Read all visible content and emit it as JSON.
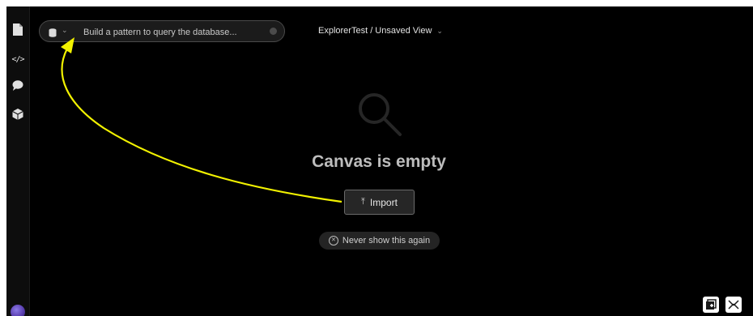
{
  "sidebar": {
    "items": [
      {
        "icon": "file-icon"
      },
      {
        "icon": "code-icon",
        "glyph": "</>"
      },
      {
        "icon": "chat-icon"
      },
      {
        "icon": "cube-icon"
      }
    ],
    "avatar_icon": "avatar-icon"
  },
  "search": {
    "db_icon": "database-icon",
    "placeholder": "Build a pattern to query the database..."
  },
  "header": {
    "view_title": "ExplorerTest / Unsaved View"
  },
  "canvas": {
    "empty_icon": "search-icon",
    "empty_title": "Canvas is empty",
    "import_label": "Import",
    "never_label": "Never show this again"
  },
  "colors": {
    "background": "#000000",
    "annotation_arrow": "#f2f200"
  },
  "corner_buttons": [
    "add-node-icon",
    "layout-icon"
  ]
}
